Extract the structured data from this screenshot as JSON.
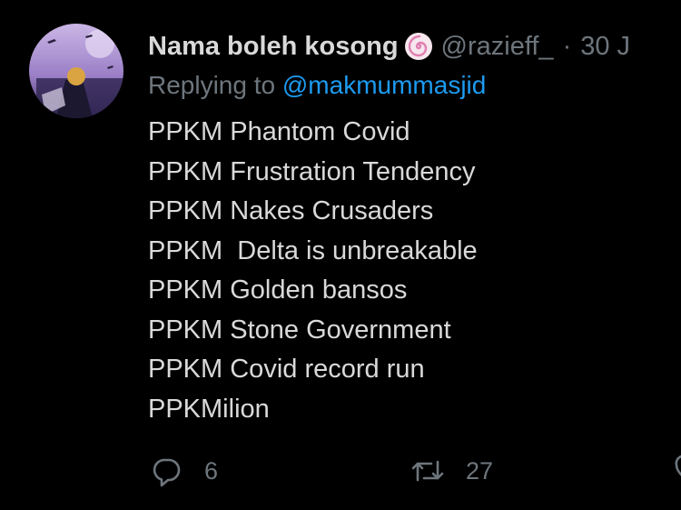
{
  "tweet": {
    "author": {
      "display_name": "Nama boleh kosong",
      "badge_icon": "spiral-swirl-emoji",
      "handle": "@razieff_",
      "separator": "·",
      "timestamp": "30 J"
    },
    "reply_context": {
      "prefix": "Replying to",
      "mention": "@makmummasjid"
    },
    "lines": [
      "PPKM Phantom Covid",
      "PPKM Frustration Tendency",
      "PPKM Nakes Crusaders",
      "PPKM  Delta is unbreakable",
      "PPKM Golden bansos",
      "PPKM Stone Government",
      "PPKM Covid record run",
      "PPKMilion"
    ],
    "actions": {
      "reply": {
        "icon": "reply-icon",
        "count": "6"
      },
      "retweet": {
        "icon": "retweet-icon",
        "count": "27"
      },
      "like": {
        "icon": "like-icon"
      }
    }
  },
  "colors": {
    "background": "#000000",
    "text": "#d9d9d9",
    "muted": "#6e767d",
    "link": "#1d9bf0",
    "badge": "#e07fb0"
  }
}
